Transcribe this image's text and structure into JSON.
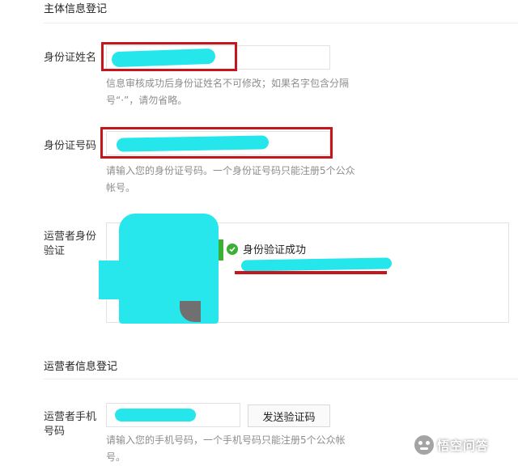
{
  "section_subject": {
    "title": "主体信息登记"
  },
  "id_name": {
    "label": "身份证姓名",
    "hint_line1": "信息审核成功后身份证姓名不可修改；如果名字包含分隔",
    "hint_line2": "号“·”，请勿省略。"
  },
  "id_number": {
    "label": "身份证号码",
    "hint_line1": "请输入您的身份证号码。一个身份证号码只能注册5个公众",
    "hint_line2": "帐号。"
  },
  "operator_verify": {
    "label_line1": "运营者身份",
    "label_line2": "验证",
    "status_text": "身份验证成功"
  },
  "section_operator": {
    "title": "运营者信息登记"
  },
  "operator_phone": {
    "label_line1": "运营者手机",
    "label_line2": "号码",
    "send_code_button": "发送验证码",
    "hint_line1": "请输入您的手机号码，一个手机号码只能注册5个公众帐",
    "hint_line2": "号。"
  },
  "watermark": {
    "text": "悟空问答"
  },
  "colors": {
    "highlight_red": "#c4161c",
    "redaction_cyan": "#25e6ea",
    "success_green": "#3cb034"
  },
  "icons": [
    "check-circle-icon",
    "wukong-logo-icon"
  ]
}
